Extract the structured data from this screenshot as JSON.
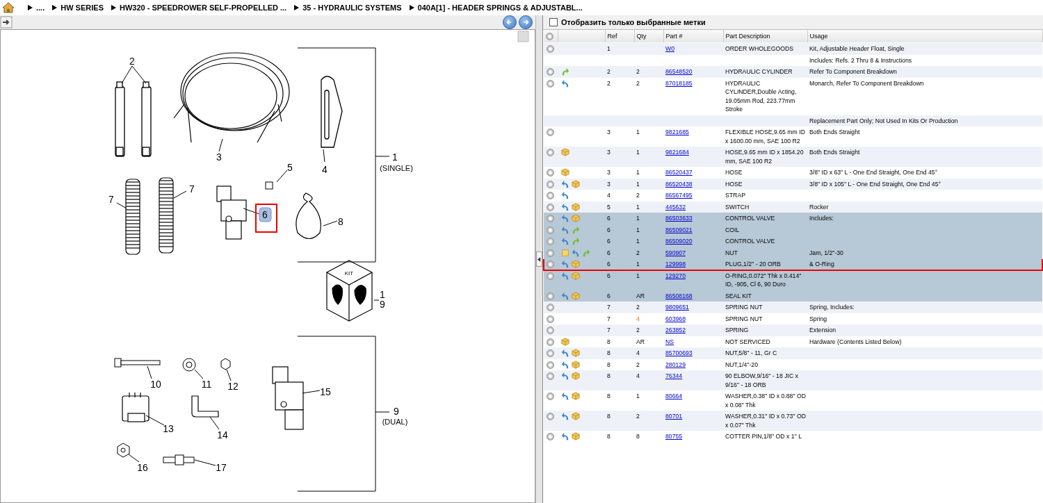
{
  "breadcrumb": [
    {
      "label": "...."
    },
    {
      "label": "HW SERIES"
    },
    {
      "label": "HW320 - SPEEDROWER SELF-PROPELLED ..."
    },
    {
      "label": "35 - HYDRAULIC SYSTEMS"
    },
    {
      "label": "040A[1] - HEADER SPRINGS & ADJUSTABL..."
    }
  ],
  "diagram": {
    "callouts": [
      {
        "text": "2",
        "selected": false
      },
      {
        "text": "3",
        "selected": false
      },
      {
        "text": "1",
        "selected": false
      },
      {
        "text": "5",
        "selected": false
      },
      {
        "text": "4",
        "selected": false
      },
      {
        "text": "(SINGLE)",
        "selected": false
      },
      {
        "text": "7",
        "selected": false
      },
      {
        "text": "7",
        "selected": false
      },
      {
        "text": "6",
        "selected": true
      },
      {
        "text": "8",
        "selected": false
      },
      {
        "text": "KIT",
        "selected": false
      },
      {
        "text": "1",
        "selected": false
      },
      {
        "text": "9",
        "selected": false
      },
      {
        "text": "10",
        "selected": false
      },
      {
        "text": "11",
        "selected": false
      },
      {
        "text": "12",
        "selected": false
      },
      {
        "text": "13",
        "selected": false
      },
      {
        "text": "14",
        "selected": false
      },
      {
        "text": "15",
        "selected": false
      },
      {
        "text": "9",
        "selected": false
      },
      {
        "text": "(DUAL)",
        "selected": false
      },
      {
        "text": "16",
        "selected": false
      },
      {
        "text": "17",
        "selected": false
      }
    ]
  },
  "filter": {
    "label": "Отобразить только выбранные метки",
    "checked": false
  },
  "table": {
    "columns": [
      "Ref",
      "Qty",
      "Part #",
      "Part Description",
      "Usage"
    ],
    "rows": [
      {
        "icons": [
          {
            "kind": "expand"
          }
        ],
        "ref": "1",
        "part": "W0",
        "description": "ORDER WHOLEGOODS",
        "usage": "Kit, Adjustable Header Float, Single",
        "highlighted": false,
        "selected": false
      },
      {
        "usage": "Includes: Refs. 2 Thru 8 & Instructions",
        "highlighted": false,
        "selected": false
      },
      {
        "icons": [
          {
            "kind": "expand"
          },
          {
            "kind": "forward"
          }
        ],
        "ref": "2",
        "qty": "2",
        "part": "86548520",
        "description": "HYDRAULIC CYLINDER",
        "usage": "Refer To Component Breakdown",
        "highlighted": false,
        "selected": false,
        "qty_alert": false
      },
      {
        "icons": [
          {
            "kind": "expand"
          },
          {
            "kind": "back"
          }
        ],
        "ref": "2",
        "qty": "2",
        "part": "87018185",
        "description": "HYDRAULIC CYLINDER,Double Acting, 19.05mm Rod, 223.77mm Stroke",
        "usage": "Monarch, Refer To Component Breakdown",
        "highlighted": false,
        "selected": false,
        "qty_alert": false
      },
      {
        "usage": "Replacement Part Only; Not Used In Kits Or Production",
        "highlighted": false,
        "selected": false
      },
      {
        "icons": [
          {
            "kind": "expand"
          }
        ],
        "ref": "3",
        "qty": "1",
        "part": "9821685",
        "description": "FLEXIBLE HOSE,9.65 mm ID x 1600.00 mm, SAE 100 R2",
        "usage": "Both Ends Straight",
        "highlighted": false,
        "selected": false,
        "qty_alert": false
      },
      {
        "icons": [
          {
            "kind": "expand"
          },
          {
            "kind": "package"
          }
        ],
        "ref": "3",
        "qty": "1",
        "part": "9821684",
        "description": "HOSE,9.65 mm ID x 1854.20 mm, SAE 100 R2",
        "usage": "Both Ends Straight",
        "highlighted": false,
        "selected": false,
        "qty_alert": false
      },
      {
        "icons": [
          {
            "kind": "expand"
          },
          {
            "kind": "package"
          }
        ],
        "ref": "3",
        "qty": "1",
        "part": "86520437",
        "description": "HOSE",
        "usage": "3/8\" ID x 63\" L - One End Straight, One End 45°",
        "highlighted": false,
        "selected": false,
        "qty_alert": false
      },
      {
        "icons": [
          {
            "kind": "expand"
          },
          {
            "kind": "back"
          },
          {
            "kind": "package"
          }
        ],
        "ref": "3",
        "qty": "1",
        "part": "86520438",
        "description": "HOSE",
        "usage": "3/8\" ID x 105\" L - One End Straight, One End 45°",
        "highlighted": false,
        "selected": false,
        "qty_alert": false
      },
      {
        "icons": [
          {
            "kind": "expand"
          },
          {
            "kind": "back"
          }
        ],
        "ref": "4",
        "qty": "2",
        "part": "86567495",
        "description": "STRAP",
        "highlighted": false,
        "selected": false,
        "qty_alert": false
      },
      {
        "icons": [
          {
            "kind": "expand"
          },
          {
            "kind": "back"
          },
          {
            "kind": "package"
          }
        ],
        "ref": "5",
        "qty": "1",
        "part": "445632",
        "description": "SWITCH",
        "usage": "Rocker",
        "highlighted": false,
        "selected": false,
        "qty_alert": false
      },
      {
        "icons": [
          {
            "kind": "expand"
          },
          {
            "kind": "back"
          },
          {
            "kind": "package"
          }
        ],
        "ref": "6",
        "qty": "1",
        "part": "86503633",
        "description": "CONTROL VALVE",
        "usage": "Includes:",
        "highlighted": true,
        "selected": false,
        "qty_alert": false
      },
      {
        "icons": [
          {
            "kind": "expand"
          },
          {
            "kind": "back"
          },
          {
            "kind": "forward"
          }
        ],
        "ref": "6",
        "qty": "1",
        "part": "86509021",
        "description": "COIL",
        "highlighted": true,
        "selected": false,
        "qty_alert": false
      },
      {
        "icons": [
          {
            "kind": "expand"
          },
          {
            "kind": "back"
          },
          {
            "kind": "forward"
          }
        ],
        "ref": "6",
        "qty": "1",
        "part": "86509020",
        "description": "CONTROL VALVE",
        "highlighted": true,
        "selected": false,
        "qty_alert": false
      },
      {
        "icons": [
          {
            "kind": "expand"
          },
          {
            "kind": "note"
          },
          {
            "kind": "back"
          },
          {
            "kind": "forward"
          }
        ],
        "ref": "6",
        "qty": "2",
        "part": "590907",
        "description": "NUT",
        "usage": "Jam, 1/2\"-30",
        "highlighted": true,
        "selected": false,
        "qty_alert": false
      },
      {
        "icons": [
          {
            "kind": "expand"
          },
          {
            "kind": "back"
          },
          {
            "kind": "package"
          }
        ],
        "ref": "6",
        "qty": "1",
        "part": "129998",
        "description": "PLUG,1/2\" - 20 ORB",
        "usage": "& O-Ring",
        "highlighted": true,
        "selected": true,
        "qty_alert": false
      },
      {
        "icons": [
          {
            "kind": "expand"
          },
          {
            "kind": "back"
          },
          {
            "kind": "package"
          }
        ],
        "ref": "6",
        "qty": "1",
        "part": "129270",
        "description": "O-RING,0.072\" Thk x 0.414\" ID, -905, Cl 6, 90 Duro",
        "highlighted": true,
        "selected": false,
        "qty_alert": false
      },
      {
        "icons": [
          {
            "kind": "expand"
          },
          {
            "kind": "back"
          },
          {
            "kind": "package"
          }
        ],
        "ref": "6",
        "qty": "AR",
        "part": "86508168",
        "description": "SEAL KIT",
        "highlighted": true,
        "selected": false,
        "qty_alert": false
      },
      {
        "icons": [
          {
            "kind": "expand"
          }
        ],
        "ref": "7",
        "qty": "2",
        "part": "9809651",
        "description": "SPRING NUT",
        "usage": "Spring, Includes:",
        "highlighted": false,
        "selected": false,
        "qty_alert": false
      },
      {
        "icons": [
          {
            "kind": "expand"
          }
        ],
        "ref": "7",
        "qty": "4",
        "part": "603968",
        "description": "SPRING NUT",
        "usage": "Spring",
        "highlighted": false,
        "selected": false,
        "qty_alert": true
      },
      {
        "icons": [
          {
            "kind": "expand"
          }
        ],
        "ref": "7",
        "qty": "2",
        "part": "263852",
        "description": "SPRING",
        "usage": "Extension",
        "highlighted": false,
        "selected": false,
        "qty_alert": false
      },
      {
        "icons": [
          {
            "kind": "expand"
          },
          {
            "kind": "package"
          }
        ],
        "ref": "8",
        "qty": "AR",
        "part": "NS",
        "description": "NOT SERVICED",
        "usage": "Hardware (Contents Listed Below)",
        "highlighted": false,
        "selected": false,
        "qty_alert": false
      },
      {
        "icons": [
          {
            "kind": "expand"
          },
          {
            "kind": "back"
          },
          {
            "kind": "package"
          }
        ],
        "ref": "8",
        "qty": "4",
        "part": "85700693",
        "description": "NUT,5/8\" - 11, Gr C",
        "highlighted": false,
        "selected": false,
        "qty_alert": false
      },
      {
        "icons": [
          {
            "kind": "expand"
          },
          {
            "kind": "back"
          },
          {
            "kind": "package"
          }
        ],
        "ref": "8",
        "qty": "2",
        "part": "280129",
        "description": "NUT,1/4\"-20",
        "highlighted": false,
        "selected": false,
        "qty_alert": false
      },
      {
        "icons": [
          {
            "kind": "expand"
          },
          {
            "kind": "back"
          },
          {
            "kind": "package"
          }
        ],
        "ref": "8",
        "qty": "4",
        "part": "76344",
        "description": "90 ELBOW,9/16\" - 18 JIC x 9/16\" - 18 ORB",
        "highlighted": false,
        "selected": false,
        "qty_alert": false
      },
      {
        "icons": [
          {
            "kind": "expand"
          },
          {
            "kind": "back"
          },
          {
            "kind": "package"
          }
        ],
        "ref": "8",
        "qty": "1",
        "part": "80664",
        "description": "WASHER,0.38\" ID x 0.88\" OD x 0.08\" Thk",
        "highlighted": false,
        "selected": false,
        "qty_alert": false
      },
      {
        "icons": [
          {
            "kind": "expand"
          },
          {
            "kind": "back"
          },
          {
            "kind": "package"
          }
        ],
        "ref": "8",
        "qty": "2",
        "part": "80701",
        "description": "WASHER,0.31\" ID x 0.73\" OD x 0.07\" Thk",
        "highlighted": false,
        "selected": false,
        "qty_alert": false
      },
      {
        "icons": [
          {
            "kind": "expand"
          },
          {
            "kind": "back"
          },
          {
            "kind": "package"
          }
        ],
        "ref": "8",
        "qty": "8",
        "part": "80755",
        "description": "COTTER PIN,1/8\" OD x 1\" L",
        "highlighted": false,
        "selected": false,
        "qty_alert": false
      }
    ]
  }
}
